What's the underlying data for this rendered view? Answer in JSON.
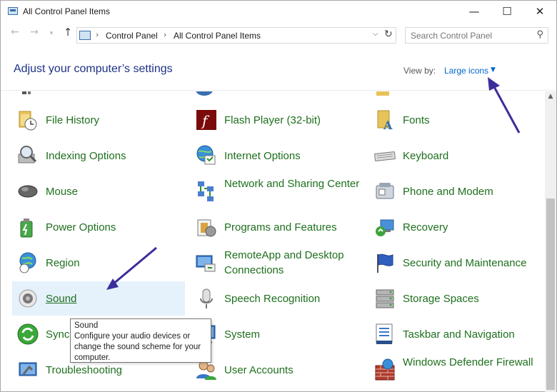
{
  "window": {
    "title": "All Control Panel Items",
    "minimize_glyph": "—",
    "maximize_glyph": "☐",
    "close_glyph": "✕"
  },
  "nav": {
    "back_glyph": "←",
    "forward_glyph": "→",
    "recent_glyph": "▾",
    "up_glyph": "↑",
    "breadcrumb": [
      "Control Panel",
      "All Control Panel Items"
    ],
    "separator_glyph": "›",
    "dropdown_glyph": "⌵",
    "refresh_glyph": "↻",
    "search_placeholder": "Search Control Panel",
    "search_icon_glyph": "⚲"
  },
  "header": {
    "heading": "Adjust your computer’s settings",
    "view_by_label": "View by:",
    "view_by_value": "Large icons",
    "view_by_caret": "▼"
  },
  "items": [
    {
      "label": "File History",
      "icon": "file-history-icon",
      "hover": false
    },
    {
      "label": "Flash Player (32-bit)",
      "icon": "flash-player-icon",
      "hover": false
    },
    {
      "label": "Fonts",
      "icon": "fonts-icon",
      "hover": false
    },
    {
      "label": "Indexing Options",
      "icon": "indexing-options-icon",
      "hover": false
    },
    {
      "label": "Internet Options",
      "icon": "internet-options-icon",
      "hover": false
    },
    {
      "label": "Keyboard",
      "icon": "keyboard-icon",
      "hover": false
    },
    {
      "label": "Mouse",
      "icon": "mouse-icon",
      "hover": false
    },
    {
      "label": "Network and Sharing Center",
      "icon": "network-sharing-icon",
      "hover": false
    },
    {
      "label": "Phone and Modem",
      "icon": "phone-modem-icon",
      "hover": false
    },
    {
      "label": "Power Options",
      "icon": "power-options-icon",
      "hover": false
    },
    {
      "label": "Programs and Features",
      "icon": "programs-features-icon",
      "hover": false
    },
    {
      "label": "Recovery",
      "icon": "recovery-icon",
      "hover": false
    },
    {
      "label": "Region",
      "icon": "region-icon",
      "hover": false
    },
    {
      "label": "RemoteApp and Desktop Connections",
      "icon": "remoteapp-icon",
      "hover": false
    },
    {
      "label": "Security and Maintenance",
      "icon": "security-maintenance-icon",
      "hover": false
    },
    {
      "label": "Sound",
      "icon": "sound-icon",
      "hover": true
    },
    {
      "label": "Speech Recognition",
      "icon": "speech-recognition-icon",
      "hover": false
    },
    {
      "label": "Storage Spaces",
      "icon": "storage-spaces-icon",
      "hover": false
    },
    {
      "label": "Sync Center",
      "icon": "sync-center-icon",
      "hover": false
    },
    {
      "label": "System",
      "icon": "system-icon",
      "hover": false
    },
    {
      "label": "Taskbar and Navigation",
      "icon": "taskbar-navigation-icon",
      "hover": false
    },
    {
      "label": "Troubleshooting",
      "icon": "troubleshooting-icon",
      "hover": false
    },
    {
      "label": "User Accounts",
      "icon": "user-accounts-icon",
      "hover": false
    },
    {
      "label": "Windows Defender Firewall",
      "icon": "firewall-icon",
      "hover": false
    }
  ],
  "tooltip": {
    "title": "Sound",
    "body": "Configure your audio devices or change the sound scheme for your computer."
  },
  "scrollbar": {
    "up_glyph": "▲"
  },
  "colors": {
    "link_green": "#1e6f1e",
    "heading_blue": "#1e3287",
    "accent_blue": "#0066cc",
    "hover_bg": "#e5f1fb",
    "annotation_arrow": "#3b2e9a"
  }
}
